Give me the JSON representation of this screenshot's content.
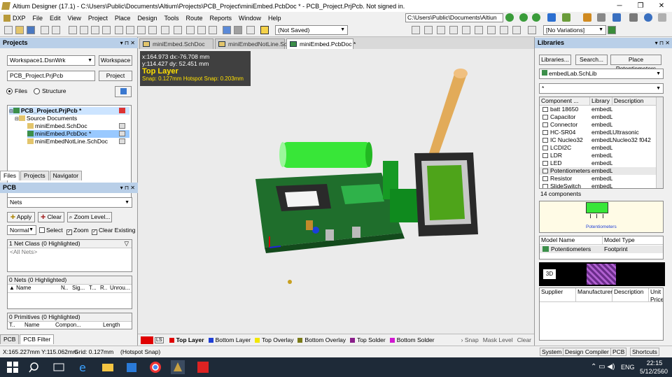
{
  "window": {
    "title": "Altium Designer (17.1) - C:\\Users\\Public\\Documents\\Altium\\Projects\\PCB_Project\\miniEmbed.PcbDoc * - PCB_Project.PrjPcb. Not signed in.",
    "controls": [
      "─",
      "❐",
      "✕"
    ]
  },
  "menu": {
    "items": [
      "DXP",
      "File",
      "Edit",
      "View",
      "Project",
      "Place",
      "Design",
      "Tools",
      "Route",
      "Reports",
      "Window",
      "Help"
    ],
    "path": "C:\\Users\\Public\\Documents\\Altiun"
  },
  "toolbar": {
    "save_state": "(Not Saved)",
    "variations": "[No Variations]"
  },
  "projects_panel": {
    "title": "Projects",
    "workspace_value": "Workspace1.DsnWrk",
    "workspace_button": "Workspace",
    "project_value": "PCB_Project.PrjPcb",
    "project_button": "Project",
    "radio_files": "Files",
    "radio_structure": "Structure",
    "tree": {
      "project": "PCB_Project.PrjPcb *",
      "folder": "Source Documents",
      "docs": [
        "miniEmbed.SchDoc",
        "miniEmbed.PcbDoc *",
        "miniEmbedNotLine.SchDoc"
      ]
    },
    "tabs": [
      "Files",
      "Projects",
      "Navigator"
    ]
  },
  "pcb_panel": {
    "title": "PCB",
    "mode_value": "Nets",
    "apply": "Apply",
    "clear": "Clear",
    "zoom_level": "Zoom Level...",
    "highlight_mode": "Normal",
    "chk_select": "Select",
    "chk_zoom": "Zoom",
    "chk_clear_existing": "Clear Existing",
    "net_class_header": "1 Net Class (0 Highlighted)",
    "net_class_item": "<All Nets>",
    "nets_header": "0 Nets (0 Highlighted)",
    "nets_columns": [
      "Name",
      "N..",
      "Sig...",
      "T...",
      "R..",
      "Unrou..."
    ],
    "primitives_header": "0 Primitives (0 Highlighted)",
    "primitives_columns": [
      "T..",
      "Name",
      "Compon...",
      "Length"
    ],
    "tabs": [
      "PCB",
      "PCB Filter"
    ]
  },
  "doc_tabs": [
    "miniEmbed.SchDoc",
    "miniEmbedNotLine.SchDoc",
    "miniEmbed.PcbDoc *"
  ],
  "hud": {
    "line1": "x:164.973  dx:-76.708 mm",
    "line2": "y:114.427  dy: 52.451 mm",
    "layer": "Top Layer",
    "snap": "Snap: 0.127mm Hotspot Snap: 0.203mm"
  },
  "layer_bar": {
    "ls": "LS",
    "layers": [
      {
        "name": "Top Layer",
        "color": "#e00000",
        "bold": true
      },
      {
        "name": "Bottom Layer",
        "color": "#1f3fd6",
        "bold": false
      },
      {
        "name": "Top Overlay",
        "color": "#f2e600",
        "bold": false
      },
      {
        "name": "Bottom Overlay",
        "color": "#7a7a19",
        "bold": false
      },
      {
        "name": "Top Solder",
        "color": "#8a1f8a",
        "bold": false
      },
      {
        "name": "Bottom Solder",
        "color": "#d018d0",
        "bold": false
      }
    ],
    "right": [
      "Snap",
      "Mask Level",
      "Clear"
    ]
  },
  "libraries_panel": {
    "title": "Libraries",
    "btn_libraries": "Libraries...",
    "btn_search": "Search...",
    "btn_place": "Place Potentiometers",
    "library": "embedLab.SchLib",
    "filter": "*",
    "columns": [
      "Component ...",
      "Library",
      "Description"
    ],
    "components": [
      {
        "name": "batt 18650",
        "lib": "embedLi",
        "desc": ""
      },
      {
        "name": "Capacitor",
        "lib": "embedLi",
        "desc": ""
      },
      {
        "name": "Connector",
        "lib": "embedLi",
        "desc": ""
      },
      {
        "name": "HC-SR04",
        "lib": "embedLi",
        "desc": "Ultrasonic"
      },
      {
        "name": "IC Nucleo32",
        "lib": "embedLi",
        "desc": "Nucleo32 f042"
      },
      {
        "name": "LCDI2C",
        "lib": "embedLi",
        "desc": ""
      },
      {
        "name": "LDR",
        "lib": "embedLi",
        "desc": ""
      },
      {
        "name": "LED",
        "lib": "embedLi",
        "desc": ""
      },
      {
        "name": "Potentiometers",
        "lib": "embedLi",
        "desc": ""
      },
      {
        "name": "Resistor",
        "lib": "embedLi",
        "desc": ""
      },
      {
        "name": "SlideSwitch",
        "lib": "embedLi",
        "desc": ""
      }
    ],
    "count": "14 components",
    "preview_label": "Potentiometers",
    "model_columns": [
      "Model Name",
      "Model Type"
    ],
    "model_row": {
      "name": "Potentiometers",
      "type": "Footprint"
    },
    "model_3d_label": "3D",
    "supplier_columns": [
      "Supplier",
      "Manufacturer",
      "Description",
      "Unit Price"
    ]
  },
  "status_bar": {
    "coords": "X:165.227mm Y:115.062mm",
    "grid": "Grid: 0.127mm",
    "snap": "(Hotspot Snap)",
    "right_tabs": [
      "System",
      "Design Compiler",
      "PCB",
      "Shortcuts"
    ]
  },
  "taskbar": {
    "time": "22:15",
    "date": "5/12/2560",
    "lang": "ENG"
  }
}
